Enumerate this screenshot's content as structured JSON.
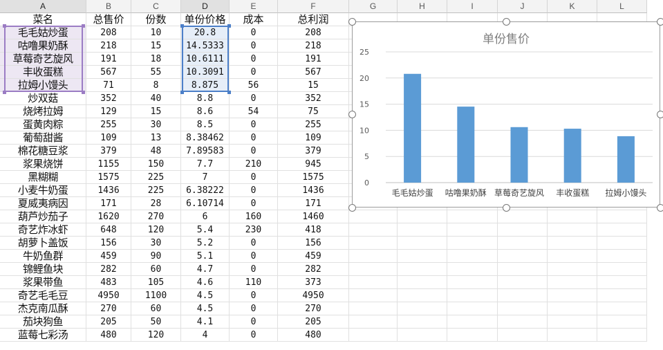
{
  "columns": [
    "A",
    "B",
    "C",
    "D",
    "E",
    "F",
    "G",
    "H",
    "I",
    "J",
    "K",
    "L"
  ],
  "headers": [
    "菜名",
    "总售价",
    "份数",
    "单份价格",
    "成本",
    "总利润"
  ],
  "rows": [
    [
      "毛毛姑炒蛋",
      "208",
      "10",
      "20.8",
      "0",
      "208"
    ],
    [
      "咕噜果奶酥",
      "218",
      "15",
      "14.5333",
      "0",
      "218"
    ],
    [
      "草莓奇艺旋风",
      "191",
      "18",
      "10.6111",
      "0",
      "191"
    ],
    [
      "丰收蛋糕",
      "567",
      "55",
      "10.3091",
      "0",
      "567"
    ],
    [
      "拉姆小馒头",
      "71",
      "8",
      "8.875",
      "56",
      "15"
    ],
    [
      "炒双菇",
      "352",
      "40",
      "8.8",
      "0",
      "352"
    ],
    [
      "烧烤拉姆",
      "129",
      "15",
      "8.6",
      "54",
      "75"
    ],
    [
      "蛋黄肉粽",
      "255",
      "30",
      "8.5",
      "0",
      "255"
    ],
    [
      "葡萄甜酱",
      "109",
      "13",
      "8.38462",
      "0",
      "109"
    ],
    [
      "棉花糖豆浆",
      "379",
      "48",
      "7.89583",
      "0",
      "379"
    ],
    [
      "浆果烧饼",
      "1155",
      "150",
      "7.7",
      "210",
      "945"
    ],
    [
      "黑糊糊",
      "1575",
      "225",
      "7",
      "0",
      "1575"
    ],
    [
      "小麦牛奶蛋",
      "1436",
      "225",
      "6.38222",
      "0",
      "1436"
    ],
    [
      "夏威夷病因",
      "171",
      "28",
      "6.10714",
      "0",
      "171"
    ],
    [
      "葫芦炒茄子",
      "1620",
      "270",
      "6",
      "160",
      "1460"
    ],
    [
      "奇艺炸冰虾",
      "648",
      "120",
      "5.4",
      "230",
      "418"
    ],
    [
      "胡萝卜盖饭",
      "156",
      "30",
      "5.2",
      "0",
      "156"
    ],
    [
      "牛奶鱼群",
      "459",
      "90",
      "5.1",
      "0",
      "459"
    ],
    [
      "锦鲤鱼块",
      "282",
      "60",
      "4.7",
      "0",
      "282"
    ],
    [
      "浆果带鱼",
      "483",
      "105",
      "4.6",
      "110",
      "373"
    ],
    [
      "奇艺毛毛豆",
      "4950",
      "1100",
      "4.5",
      "0",
      "4950"
    ],
    [
      "杰克南瓜酥",
      "270",
      "60",
      "4.5",
      "0",
      "270"
    ],
    [
      "茄块狗鱼",
      "205",
      "50",
      "4.1",
      "0",
      "205"
    ],
    [
      "蓝莓七彩汤",
      "480",
      "120",
      "4",
      "0",
      "480"
    ]
  ],
  "chart_data": {
    "type": "bar",
    "title": "单份售价",
    "categories": [
      "毛毛姑炒蛋",
      "咕噜果奶酥",
      "草莓奇艺旋风",
      "丰收蛋糕",
      "拉姆小馒头"
    ],
    "values": [
      20.8,
      14.5333,
      10.6111,
      10.3091,
      8.875
    ],
    "ylim": [
      0,
      25
    ],
    "yticks": [
      0,
      5,
      10,
      15,
      20,
      25
    ],
    "grid": true,
    "bar_color": "#5b9bd5"
  },
  "colors": {
    "selection_name": "#9b7cc4",
    "selection_value": "#4c7fc8"
  }
}
